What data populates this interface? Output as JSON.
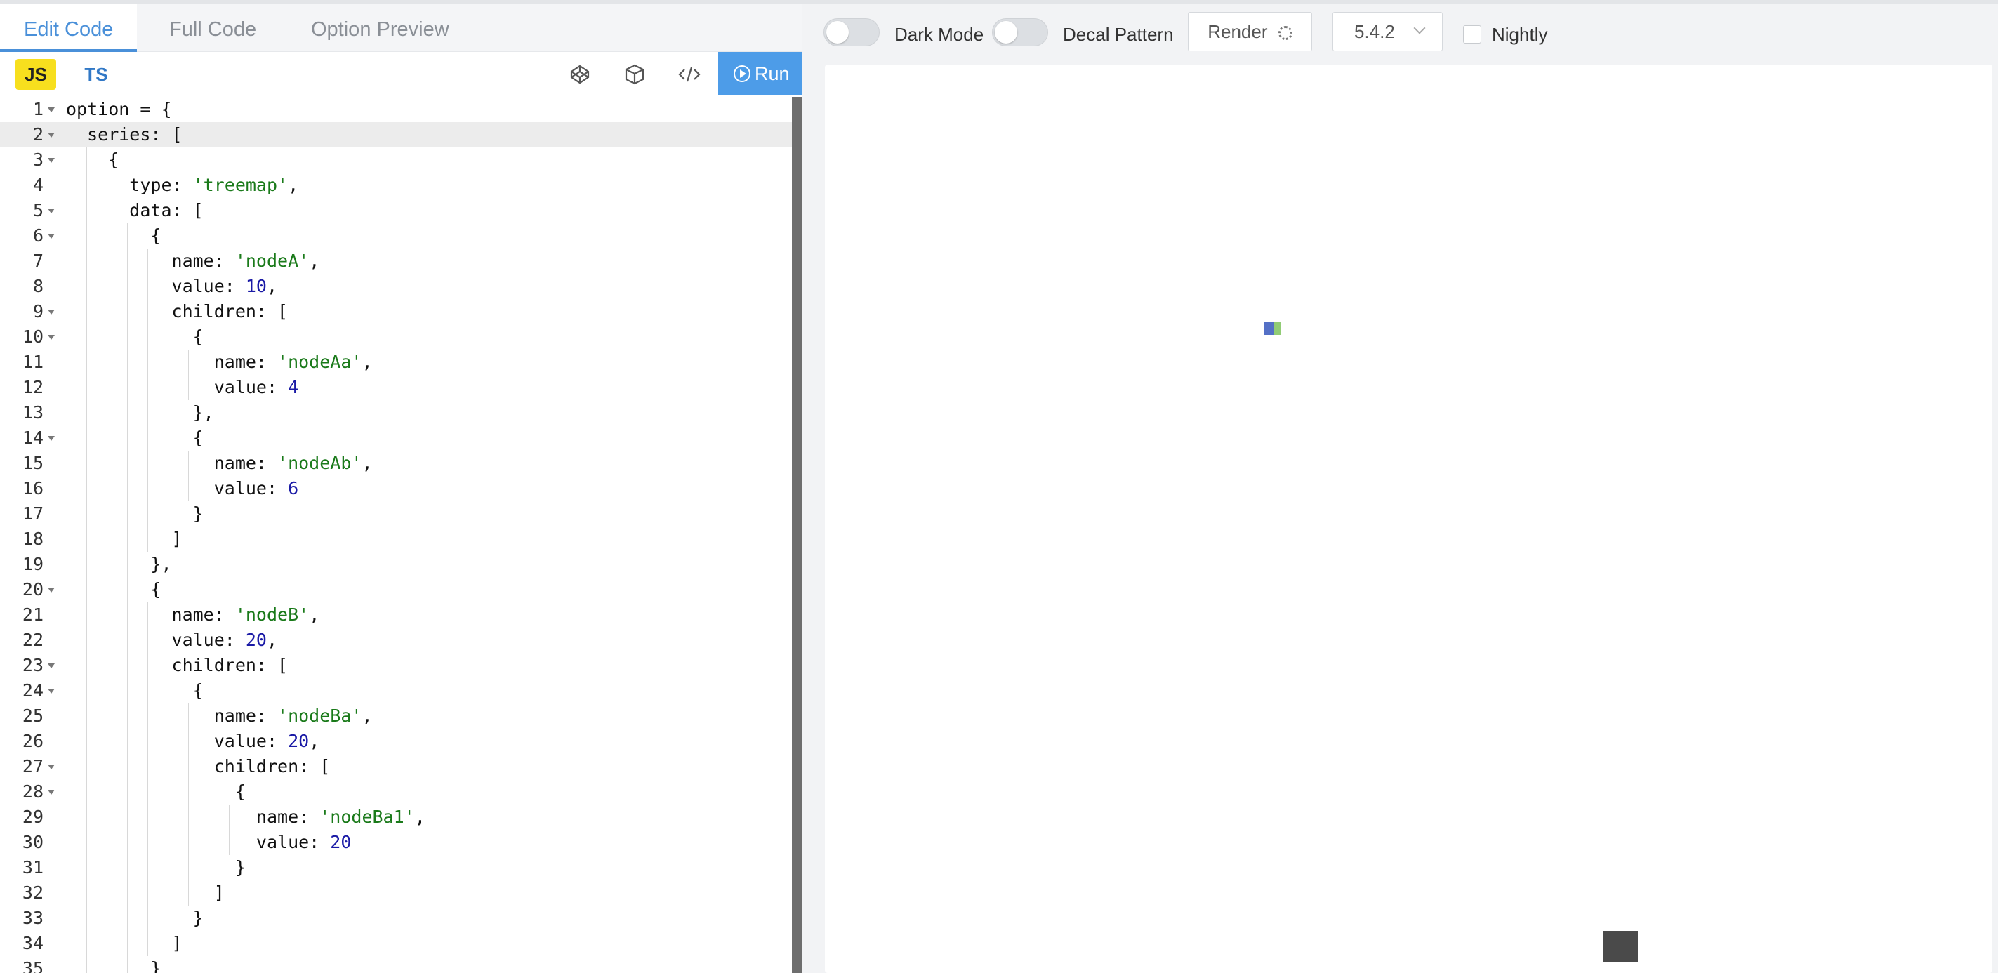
{
  "tabs": [
    "Edit Code",
    "Full Code",
    "Option Preview"
  ],
  "langs": {
    "js": "JS",
    "ts": "TS"
  },
  "run_label": "Run",
  "code_lines": [
    "option = {",
    "  series: [",
    "    {",
    "      type: 'treemap',",
    "      data: [",
    "        {",
    "          name: 'nodeA',",
    "          value: 10,",
    "          children: [",
    "            {",
    "              name: 'nodeAa',",
    "              value: 4",
    "            },",
    "            {",
    "              name: 'nodeAb',",
    "              value: 6",
    "            }",
    "          ]",
    "        },",
    "        {",
    "          name: 'nodeB',",
    "          value: 20,",
    "          children: [",
    "            {",
    "              name: 'nodeBa',",
    "              value: 20,",
    "              children: [",
    "                {",
    "                  name: 'nodeBa1',",
    "                  value: 20",
    "                }",
    "              ]",
    "            }",
    "          ]",
    "        }"
  ],
  "toolbar": {
    "dark_mode": "Dark Mode",
    "decal_pattern": "Decal Pattern",
    "render": "Render",
    "version": "5.4.2",
    "nightly": "Nightly"
  },
  "colors": {
    "accent": "#4a90d9",
    "run_bg": "#4d9ce8",
    "js_badge": "#f7df1e",
    "string": "#1a7a1a",
    "number": "#1a1aa6",
    "treemap_blue": "#5470c6",
    "treemap_green": "#91cc75",
    "breadcrumb": "#4a4a4a"
  }
}
